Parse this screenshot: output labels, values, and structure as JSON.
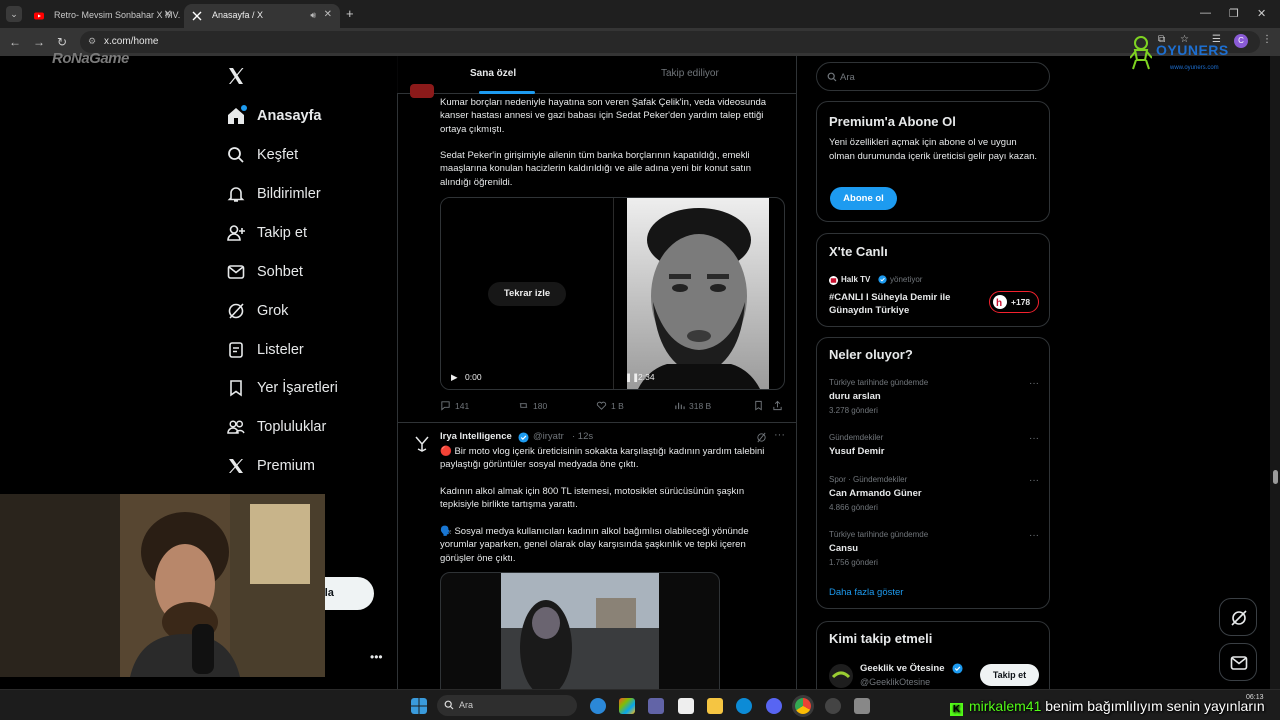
{
  "browser": {
    "tabs": [
      {
        "title": "Retro- Mevsim Sonbahar X MV...",
        "favicon": "youtube-icon",
        "active": false
      },
      {
        "title": "Anasayfa / X",
        "favicon": "x-icon",
        "active": true
      }
    ],
    "url": "x.com/home",
    "profile_initial": "C"
  },
  "nav": {
    "items": [
      {
        "label": "Anasayfa",
        "icon": "home-icon"
      },
      {
        "label": "Keşfet",
        "icon": "search-icon"
      },
      {
        "label": "Bildirimler",
        "icon": "bell-icon"
      },
      {
        "label": "Takip et",
        "icon": "follow-icon"
      },
      {
        "label": "Sohbet",
        "icon": "mail-icon"
      },
      {
        "label": "Grok",
        "icon": "grok-icon"
      },
      {
        "label": "Listeler",
        "icon": "list-icon"
      },
      {
        "label": "Yer İşaretleri",
        "icon": "bookmark-icon"
      },
      {
        "label": "Topluluklar",
        "icon": "communities-icon"
      },
      {
        "label": "Premium",
        "icon": "x-icon"
      }
    ],
    "post_button_tail": "nla"
  },
  "timeline": {
    "tabs": [
      {
        "label": "Sana özel"
      },
      {
        "label": "Takip ediliyor"
      }
    ],
    "tweet1": {
      "para1": "Kumar borçları nedeniyle hayatına son veren Şafak Çelik'in, veda videosunda kanser hastası annesi ve gazi babası için Sedat Peker'den yardım talep ettiği ortaya çıkmıştı.",
      "para2": "Sedat Peker'in girişimiyle ailenin tüm banka borçlarının kapatıldığı, emekli maaşlarına konulan hacizlerin kaldırıldığı ve aile adına yeni bir konut satın alındığı öğrenildi.",
      "replay_label": "Tekrar izle",
      "video_left_time": "0:00",
      "video_right_time": "2:34",
      "stats": {
        "replies": "141",
        "reposts": "180",
        "likes": "1 B",
        "views": "318 B"
      }
    },
    "tweet2": {
      "author": "Irya Intelligence",
      "handle": "@iryatr",
      "time": "· 12s",
      "para1": "🔴 Bir moto vlog içerik üreticisinin sokakta karşılaştığı kadının yardım talebini paylaştığı görüntüler sosyal medyada öne çıktı.",
      "para2": "Kadının alkol almak için 800 TL istemesi, motosiklet sürücüsünün şaşkın tepkisiyle birlikte tartışma yarattı.",
      "para3": "🗣️ Sosyal medya kullanıcıları kadının alkol bağımlısı olabileceği yönünde yorumlar yaparken, genel olarak olay karşısında şaşkınlık ve tepki içeren görüşler öne çıktı."
    }
  },
  "sidebar": {
    "search_placeholder": "Ara",
    "premium": {
      "title": "Premium'a Abone Ol",
      "text": "Yeni özellikleri açmak için abone ol ve uygun olman durumunda içerik üreticisi gelir payı kazan.",
      "button": "Abone ol"
    },
    "live": {
      "title": "X'te Canlı",
      "host": "Halk TV",
      "host_suffix": "yönetiyor",
      "title_text": "#CANLI I Süheyla Demir ile Günaydın Türkiye",
      "listeners": "+178"
    },
    "trends": {
      "title": "Neler oluyor?",
      "items": [
        {
          "context": "Türkiye tarihinde gündemde",
          "title": "duru arslan",
          "count": "3.278 gönderi"
        },
        {
          "context": "Gündemdekiler",
          "title": "Yusuf Demir",
          "count": ""
        },
        {
          "context": "Spor · Gündemdekiler",
          "title": "Can Armando Güner",
          "count": "4.866 gönderi"
        },
        {
          "context": "Türkiye tarihinde gündemde",
          "title": "Cansu",
          "count": "1.756 gönderi"
        }
      ],
      "show_more": "Daha fazla göster"
    },
    "who_to_follow": {
      "title": "Kimi takip etmeli",
      "name": "Geeklik ve Ötesine",
      "handle": "@GeeklikOtesine",
      "button": "Takip et"
    }
  },
  "watermarks": {
    "left": "RoNaGame",
    "right_title": "OYUNERS",
    "right_url": "www.oyuners.com"
  },
  "taskbar": {
    "search_placeholder": "Ara",
    "clock": "06:13"
  },
  "chat": {
    "user": "mirkalem41",
    "message": "benim bağımlılıyım senin yayınların"
  },
  "colors": {
    "accent": "#1d9bf0",
    "background": "#000000",
    "border": "#2f3336",
    "muted": "#71767b"
  }
}
